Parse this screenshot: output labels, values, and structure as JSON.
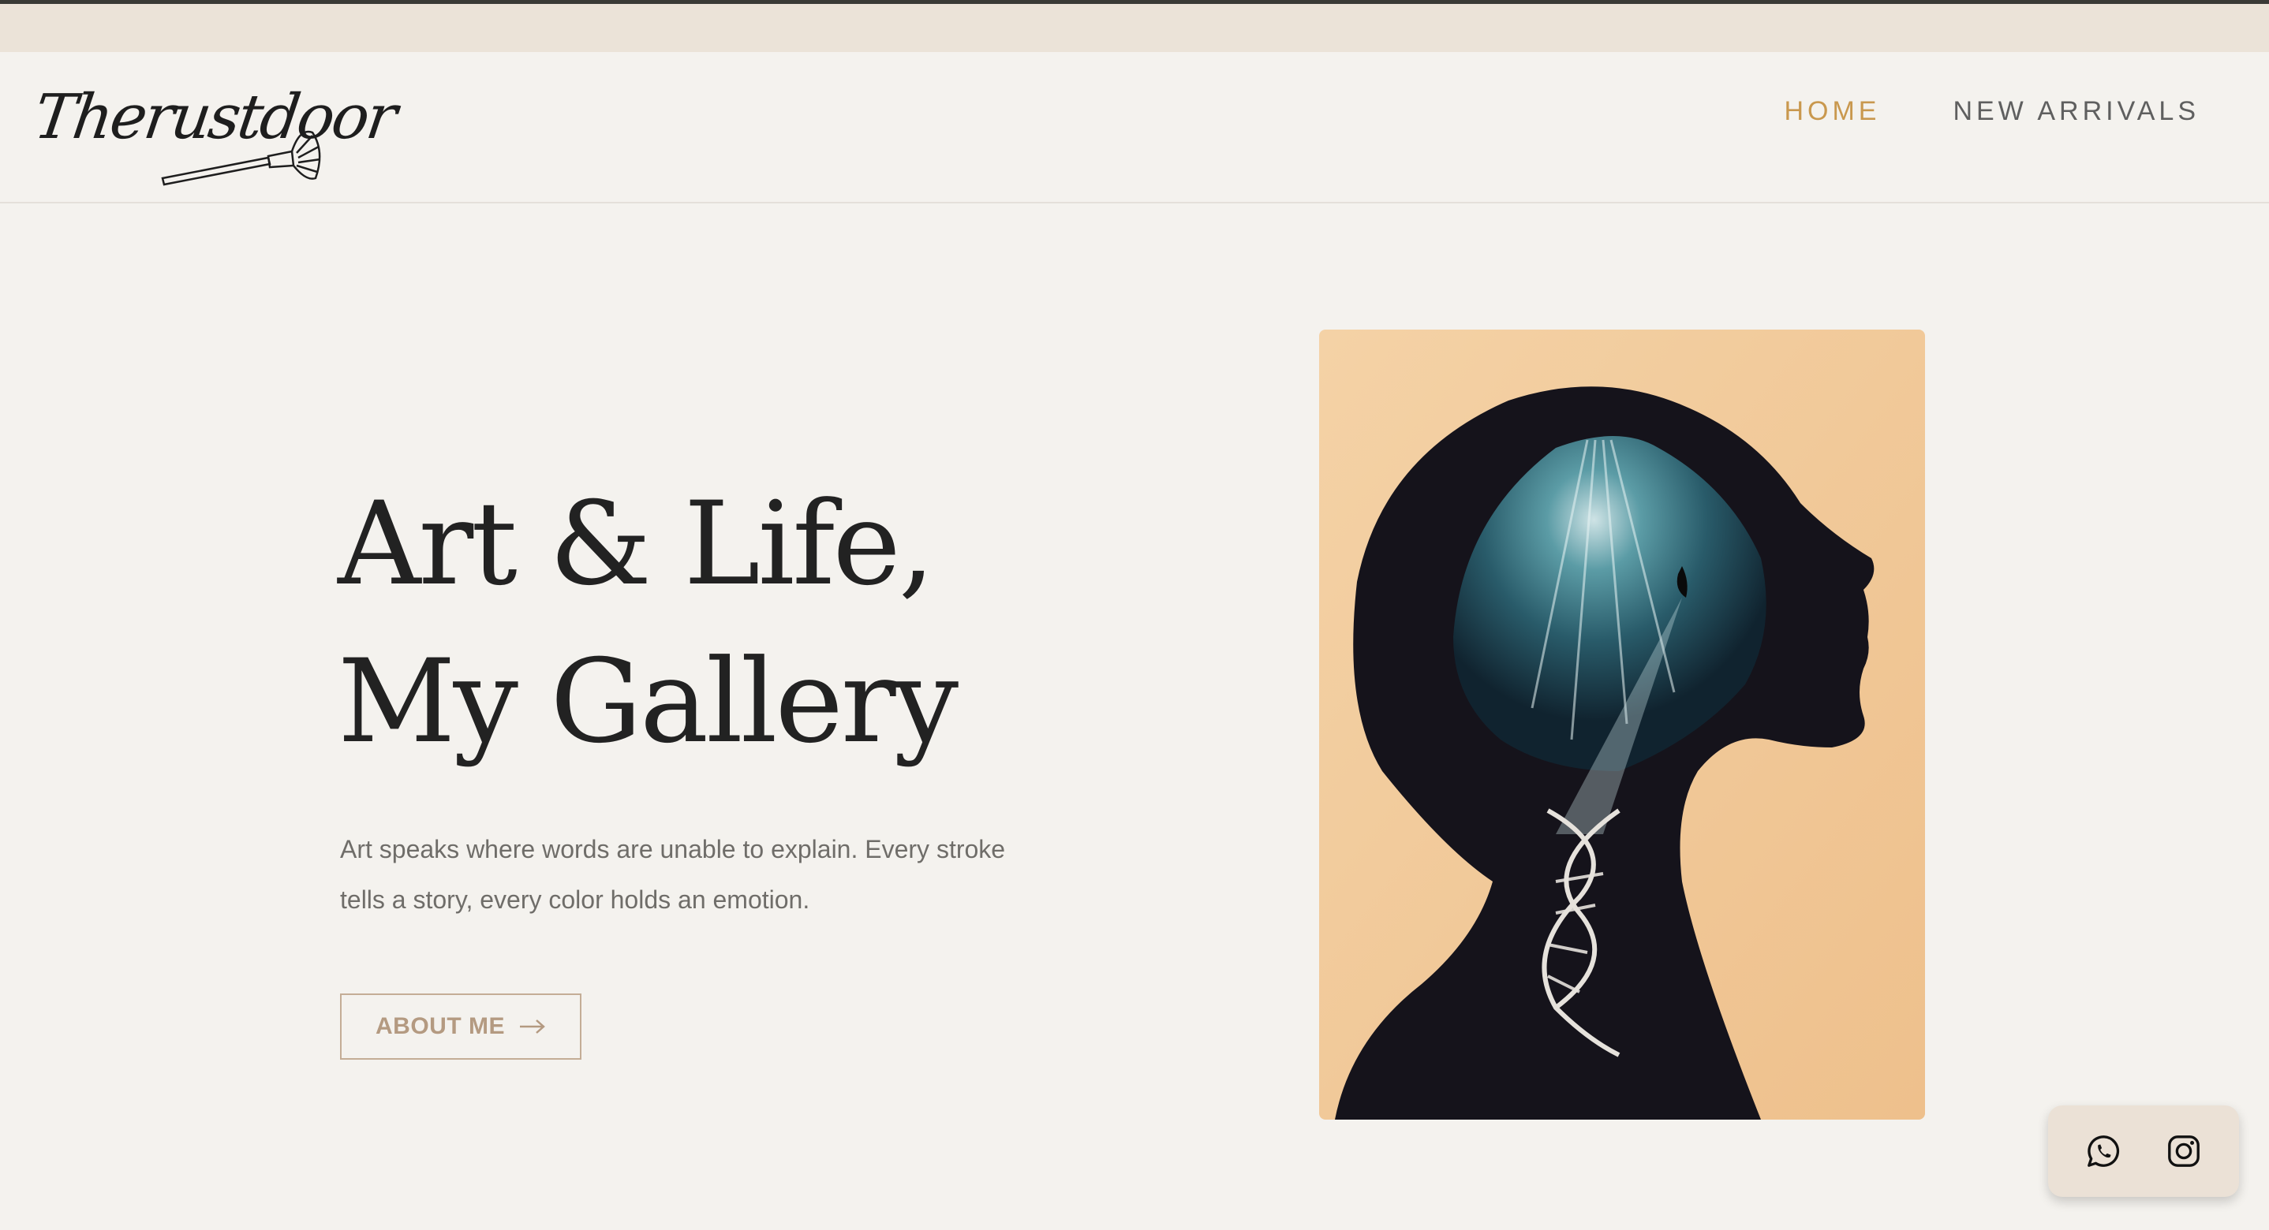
{
  "brand": {
    "logo_text": "Therustdoor"
  },
  "nav": {
    "home_label": "HOME",
    "new_arrivals_label": "NEW ARRIVALS",
    "active_color": "#c9984e"
  },
  "hero": {
    "title_line1": "Art & Life,",
    "title_line2": "My Gallery",
    "description": "Art speaks where words are unable to explain. Every stroke tells a story, every color holds an emotion.",
    "cta_label": "ABOUT ME",
    "cta_icon": "arrow-right-icon"
  },
  "artwork": {
    "background_color": "#f0c896",
    "silhouette_color": "#14121a",
    "accent_color": "#3f7c8a"
  },
  "social": {
    "icons": [
      "whatsapp-icon",
      "instagram-icon"
    ],
    "background_color": "#ebe1d6"
  }
}
